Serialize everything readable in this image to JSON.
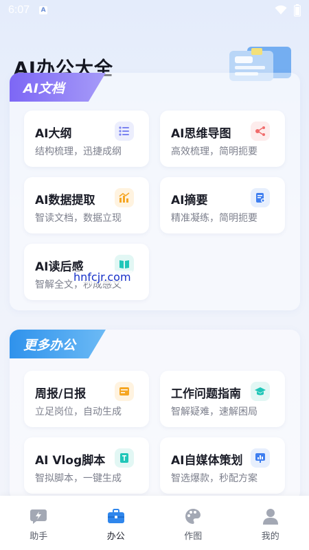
{
  "status_bar": {
    "time": "6:07",
    "a_badge": "A"
  },
  "page": {
    "title": "AI办公大全"
  },
  "sections": [
    {
      "tab_label": "AI文档",
      "cards": [
        {
          "title": "AI大纲",
          "subtitle": "结构梳理，迅捷成纲",
          "icon": "list-icon",
          "icon_color": "#7b83f0"
        },
        {
          "title": "AI思维导图",
          "subtitle": "高效梳理，简明扼要",
          "icon": "mindmap-icon",
          "icon_color": "#f06b6b"
        },
        {
          "title": "AI数据提取",
          "subtitle": "智读文档，数据立现",
          "icon": "bar-chart-icon",
          "icon_color": "#f5a623"
        },
        {
          "title": "AI摘要",
          "subtitle": "精准凝练，简明扼要",
          "icon": "document-star-icon",
          "icon_color": "#3f7ff0"
        },
        {
          "title": "AI读后感",
          "subtitle": "智解全文，秒成感文",
          "icon": "book-icon",
          "icon_color": "#20c6b8"
        }
      ]
    },
    {
      "tab_label": "更多办公",
      "cards": [
        {
          "title": "周报/日报",
          "subtitle": "立足岗位，自动生成",
          "icon": "report-icon",
          "icon_color": "#f5a623"
        },
        {
          "title": "工作问题指南",
          "subtitle": "智解疑难，速解困局",
          "icon": "graduation-cap-icon",
          "icon_color": "#20c6b8"
        },
        {
          "title": "AI Vlog脚本",
          "subtitle": "智拟脚本，一键生成",
          "icon": "script-icon",
          "icon_color": "#20c6b8"
        },
        {
          "title": "AI自媒体策划",
          "subtitle": "智选爆款，秒配方案",
          "icon": "presentation-icon",
          "icon_color": "#3f7ff0"
        }
      ]
    }
  ],
  "watermark": "hnfcjr.com",
  "bottom_nav": [
    {
      "label": "助手",
      "icon": "lightning-chat-icon",
      "active": false
    },
    {
      "label": "办公",
      "icon": "briefcase-icon",
      "active": true
    },
    {
      "label": "作图",
      "icon": "palette-icon",
      "active": false
    },
    {
      "label": "我的",
      "icon": "user-icon",
      "active": false
    }
  ],
  "colors": {
    "accent_blue": "#2f86ec",
    "tab_purple": "#7d67f5",
    "tab_blue": "#2f92ec",
    "inactive_icon": "#a3a8b4"
  }
}
